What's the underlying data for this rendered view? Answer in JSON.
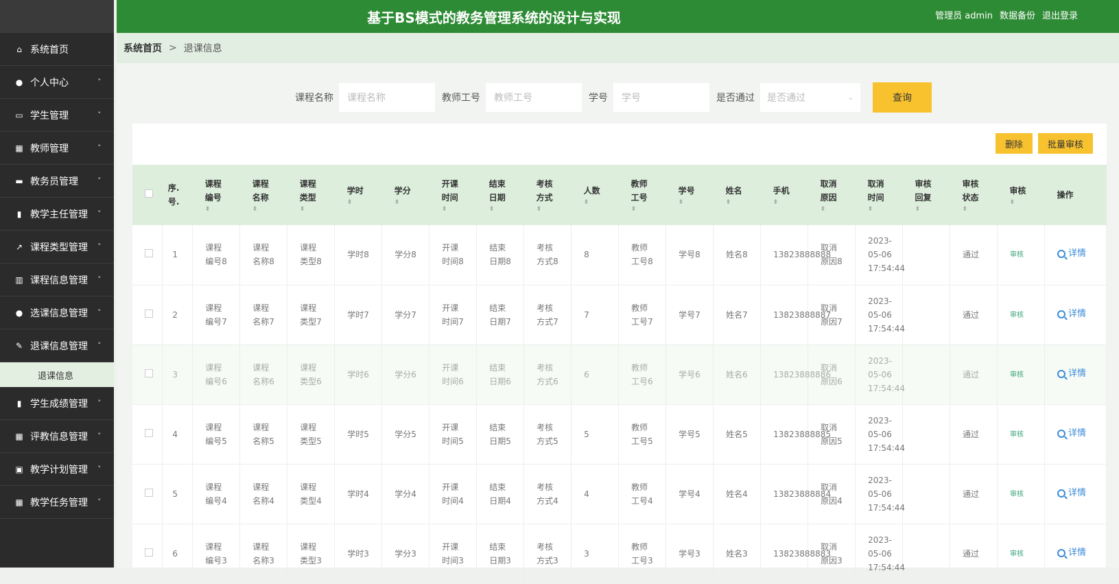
{
  "sidebar": {
    "items": [
      {
        "label": "系统首页",
        "icon": "home-icon"
      },
      {
        "label": "个人中心",
        "icon": "user-icon"
      },
      {
        "label": "学生管理",
        "icon": "monitor-icon"
      },
      {
        "label": "教师管理",
        "icon": "grid-icon"
      },
      {
        "label": "教务员管理",
        "icon": "keyboard-icon"
      },
      {
        "label": "教学主任管理",
        "icon": "book-icon"
      },
      {
        "label": "课程类型管理",
        "icon": "chart-line-icon"
      },
      {
        "label": "课程信息管理",
        "icon": "bar-chart-icon"
      },
      {
        "label": "选课信息管理",
        "icon": "user-icon"
      },
      {
        "label": "退课信息管理",
        "icon": "edit-icon"
      },
      {
        "label": "学生成绩管理",
        "icon": "book-icon"
      },
      {
        "label": "评教信息管理",
        "icon": "grid-icon"
      },
      {
        "label": "教学计划管理",
        "icon": "clipboard-icon"
      },
      {
        "label": "教学任务管理",
        "icon": "grid-icon"
      }
    ],
    "sub_item": "退课信息"
  },
  "header": {
    "title": "基于BS模式的教务管理系统的设计与实现",
    "admin": "管理员 admin",
    "backup": "数据备份",
    "logout": "退出登录"
  },
  "breadcrumb": {
    "home": "系统首页",
    "sep": ">",
    "current": "退课信息"
  },
  "search": {
    "course_name_label": "课程名称",
    "course_name_placeholder": "课程名称",
    "teacher_id_label": "教师工号",
    "teacher_id_placeholder": "教师工号",
    "student_id_label": "学号",
    "student_id_placeholder": "学号",
    "passed_label": "是否通过",
    "passed_placeholder": "是否通过",
    "query_button": "查询"
  },
  "actions": {
    "delete": "删除",
    "batch_audit": "批量审核"
  },
  "table": {
    "headers": [
      "序.号.",
      "课程编号",
      "课程名称",
      "课程类型",
      "学时",
      "学分",
      "开课时间",
      "结束日期",
      "考核方式",
      "人数",
      "教师工号",
      "学号",
      "姓名",
      "手机",
      "取消原因",
      "取消时间",
      "审核回复",
      "审核状态",
      "审核",
      "操作"
    ],
    "rows": [
      {
        "no": "1",
        "code": "课程编号8",
        "name": "课程名称8",
        "type": "课程类型8",
        "hours": "学时8",
        "credit": "学分8",
        "start": "开课时间8",
        "end": "结束日期8",
        "exam": "考核方式8",
        "count": "8",
        "teacher": "教师工号8",
        "sid": "学号8",
        "sname": "姓名8",
        "phone": "13823888888",
        "reason": "取消原因8",
        "time": "2023-05-06 17:54:44",
        "reply": "",
        "status": "通过",
        "audit": "审核",
        "op": "详情"
      },
      {
        "no": "2",
        "code": "课程编号7",
        "name": "课程名称7",
        "type": "课程类型7",
        "hours": "学时7",
        "credit": "学分7",
        "start": "开课时间7",
        "end": "结束日期7",
        "exam": "考核方式7",
        "count": "7",
        "teacher": "教师工号7",
        "sid": "学号7",
        "sname": "姓名7",
        "phone": "13823888887",
        "reason": "取消原因7",
        "time": "2023-05-06 17:54:44",
        "reply": "",
        "status": "通过",
        "audit": "审核",
        "op": "详情"
      },
      {
        "no": "3",
        "code": "课程编号6",
        "name": "课程名称6",
        "type": "课程类型6",
        "hours": "学时6",
        "credit": "学分6",
        "start": "开课时间6",
        "end": "结束日期6",
        "exam": "考核方式6",
        "count": "6",
        "teacher": "教师工号6",
        "sid": "学号6",
        "sname": "姓名6",
        "phone": "13823888886",
        "reason": "取消原因6",
        "time": "2023-05-06 17:54:44",
        "reply": "",
        "status": "通过",
        "audit": "审核",
        "op": "详情"
      },
      {
        "no": "4",
        "code": "课程编号5",
        "name": "课程名称5",
        "type": "课程类型5",
        "hours": "学时5",
        "credit": "学分5",
        "start": "开课时间5",
        "end": "结束日期5",
        "exam": "考核方式5",
        "count": "5",
        "teacher": "教师工号5",
        "sid": "学号5",
        "sname": "姓名5",
        "phone": "13823888885",
        "reason": "取消原因5",
        "time": "2023-05-06 17:54:44",
        "reply": "",
        "status": "通过",
        "audit": "审核",
        "op": "详情"
      },
      {
        "no": "5",
        "code": "课程编号4",
        "name": "课程名称4",
        "type": "课程类型4",
        "hours": "学时4",
        "credit": "学分4",
        "start": "开课时间4",
        "end": "结束日期4",
        "exam": "考核方式4",
        "count": "4",
        "teacher": "教师工号4",
        "sid": "学号4",
        "sname": "姓名4",
        "phone": "13823888884",
        "reason": "取消原因4",
        "time": "2023-05-06 17:54:44",
        "reply": "",
        "status": "通过",
        "audit": "审核",
        "op": "详情"
      },
      {
        "no": "6",
        "code": "课程编号3",
        "name": "课程名称3",
        "type": "课程类型3",
        "hours": "学时3",
        "credit": "学分3",
        "start": "开课时间3",
        "end": "结束日期3",
        "exam": "考核方式3",
        "count": "3",
        "teacher": "教师工号3",
        "sid": "学号3",
        "sname": "姓名3",
        "phone": "13823888883",
        "reason": "取消原因3",
        "time": "2023-05-06 17:54:44",
        "reply": "",
        "status": "通过",
        "audit": "审核",
        "op": "详情"
      }
    ]
  },
  "colors": {
    "header_green": "#2e8b35",
    "accent_yellow": "#f8c22f",
    "sidebar_bg": "#2b2b2b"
  }
}
